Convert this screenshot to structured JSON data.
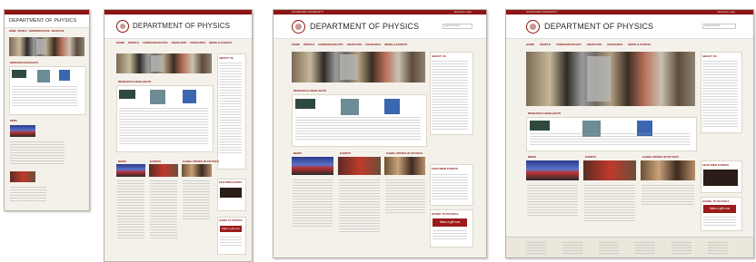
{
  "site": {
    "topbar_left": "STANFORD UNIVERSITY",
    "topbar_right": "Stanford Login",
    "title": "DEPARTMENT OF PHYSICS",
    "search_placeholder": "Search Physics"
  },
  "nav": [
    "HOME",
    "PEOPLE",
    "UNDERGRADUATE",
    "GRADUATE",
    "RESEARCH",
    "NEWS & EVENTS"
  ],
  "sections": {
    "research_highlights": "RESEARCH HIGHLIGHTS",
    "about": "ABOUT US",
    "news": "NEWS",
    "events": "EVENTS",
    "gabel": "GABEL PRIZES IN PHYSICS",
    "featured": "FEATURED EVENTS",
    "giving": "GIVING TO PHYSICS",
    "give_button": "Make a gift now"
  },
  "colors": {
    "brand": "#8c1515",
    "background": "#f4f1ea",
    "white": "#ffffff"
  }
}
